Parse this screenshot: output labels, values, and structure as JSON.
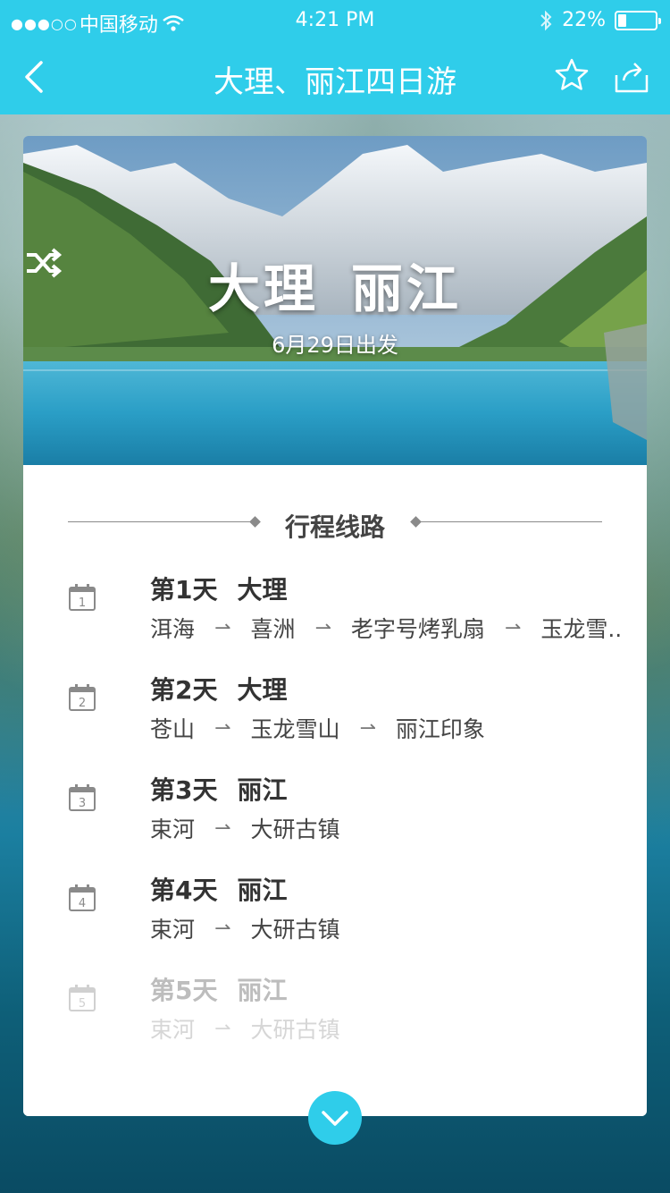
{
  "status_bar": {
    "carrier": "中国移动",
    "time": "4:21 PM",
    "battery": "22%",
    "battery_level": 0.22
  },
  "nav": {
    "title": "大理、丽江四日游"
  },
  "hero": {
    "from": "大理",
    "to": "丽江",
    "departure": "6月29日出发"
  },
  "itinerary": {
    "section_title": "行程线路",
    "days": [
      {
        "num": "1",
        "label": "第1天",
        "city": "大理",
        "stops": [
          "洱海",
          "喜洲",
          "老字号烤乳扇",
          "玉龙雪..."
        ]
      },
      {
        "num": "2",
        "label": "第2天",
        "city": "大理",
        "stops": [
          "苍山",
          "玉龙雪山",
          "丽江印象"
        ]
      },
      {
        "num": "3",
        "label": "第3天",
        "city": "丽江",
        "stops": [
          "束河",
          "大研古镇"
        ]
      },
      {
        "num": "4",
        "label": "第4天",
        "city": "丽江",
        "stops": [
          "束河",
          "大研古镇"
        ]
      },
      {
        "num": "5",
        "label": "第5天",
        "city": "丽江",
        "stops": [
          "束河",
          "大研古镇"
        ]
      }
    ]
  },
  "colors": {
    "accent": "#2fcdea"
  }
}
